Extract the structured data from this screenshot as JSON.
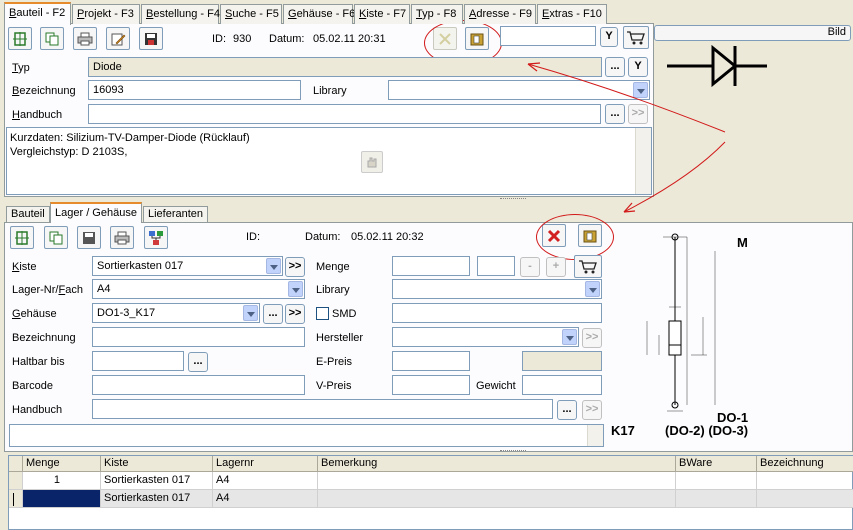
{
  "top_tabs": [
    {
      "label": "Bauteil - F2",
      "u": "B",
      "rest": "auteil - F2"
    },
    {
      "label": "Projekt - F3",
      "u": "P",
      "rest": "rojekt - F3"
    },
    {
      "label": "Bestellung - F4",
      "u": "B",
      "rest": "estellung - F4"
    },
    {
      "label": "Suche - F5",
      "u": "S",
      "rest": "uche - F5"
    },
    {
      "label": "Gehäuse - F6",
      "u": "G",
      "rest": "ehäuse - F6"
    },
    {
      "label": "Kiste - F7",
      "u": "K",
      "rest": "iste - F7"
    },
    {
      "label": "Typ - F8",
      "u": "T",
      "rest": "yp - F8"
    },
    {
      "label": "Adresse - F9",
      "u": "A",
      "rest": "dresse - F9"
    },
    {
      "label": "Extras - F10",
      "u": "E",
      "rest": "xtras - F10"
    }
  ],
  "part": {
    "id_label": "ID:",
    "id_value": "930",
    "date_label": "Datum:",
    "date_value": "05.02.11 20:31",
    "y_label": "Y",
    "bild_label": "Bild",
    "typ_label_u": "T",
    "typ_label_rest": "yp",
    "typ_value": "Diode",
    "ellipsis": "...",
    "next": ">>",
    "bez_label_u": "B",
    "bez_label_rest": "ezeichnung",
    "bez_value": "16093",
    "library_label": "Library",
    "library_value": "",
    "handbuch_label_u": "H",
    "handbuch_label_rest": "andbuch",
    "handbuch_value": "",
    "notes_line1": "Kurzdaten: Silizium-TV-Damper-Diode (Rücklauf)",
    "notes_line2": "Vergleichstyp: D 2103S,"
  },
  "sub_tabs": [
    {
      "label": "Bauteil"
    },
    {
      "label": "Lager / Gehäuse"
    },
    {
      "label": "Lieferanten"
    }
  ],
  "stock": {
    "id_label": "ID:",
    "id_value": "",
    "date_label": "Datum:",
    "date_value": "05.02.11 20:32",
    "kiste_label_u": "K",
    "kiste_label_rest": "iste",
    "kiste_value": "Sortierkasten 017",
    "lager_label": "Lager-Nr/",
    "lager_label_u": "F",
    "lager_label_rest": "ach",
    "lager_value": "A4",
    "gehaeuse_label_u": "G",
    "gehaeuse_label_rest": "ehäuse",
    "gehaeuse_value": "DO1-3_K17",
    "smd_label": "SMD",
    "bez_label": "Bezeichnung",
    "bez_value": "",
    "haltbar_label": "Haltbar bis",
    "haltbar_value": "",
    "barcode_label": "Barcode",
    "barcode_value": "",
    "handbuch_label": "Handbuch",
    "handbuch_value": "",
    "menge_label": "Menge",
    "menge_value": "",
    "menge_minus": "-",
    "menge_plus": "+",
    "library_label": "Library",
    "hersteller_label": "Hersteller",
    "epreis_label": "E-Preis",
    "vpreis_label": "V-Preis",
    "gewicht_label": "Gewicht"
  },
  "drawing": {
    "mark": "M",
    "name1": "DO-1",
    "name2": "(DO-2) (DO-3)",
    "code": "K17"
  },
  "grid": {
    "columns": [
      "Menge",
      "Kiste",
      "Lagernr",
      "Bemerkung",
      "BWare",
      "Bezeichnung"
    ],
    "rows": [
      [
        "1",
        "Sortierkasten 017",
        "A4",
        "",
        "",
        ""
      ],
      [
        "",
        "Sortierkasten 017",
        "A4",
        "",
        "",
        ""
      ]
    ]
  },
  "colors": {
    "annotation": "#d21a1a",
    "selection": "#0a246a",
    "tab_highlight": "#e68b2c"
  }
}
